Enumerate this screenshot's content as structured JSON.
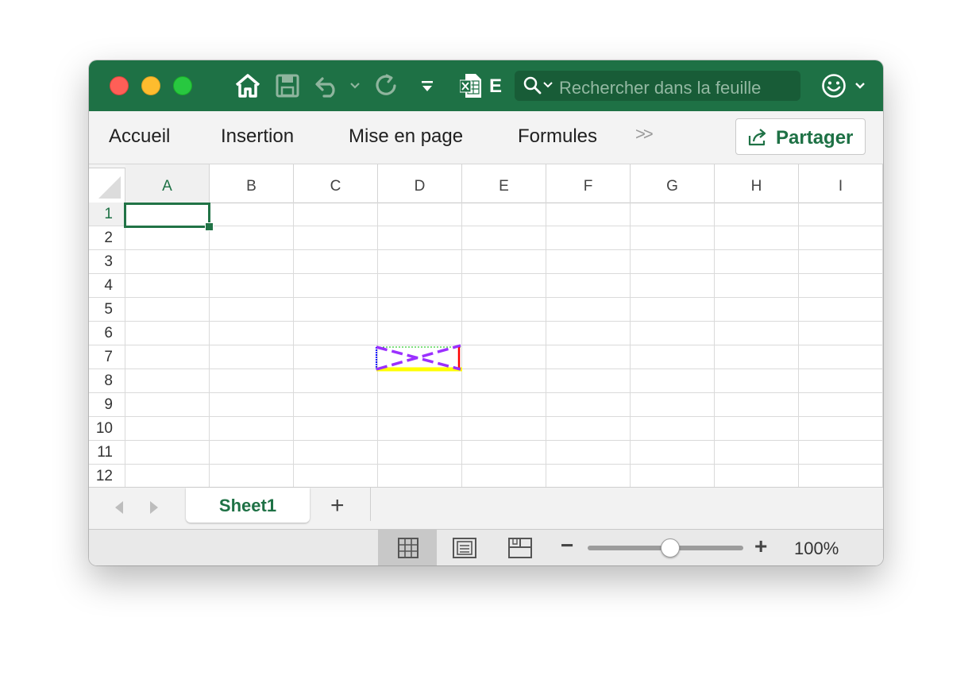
{
  "titlebar": {
    "title_fragment": "E",
    "search_placeholder": "Rechercher dans la feuille"
  },
  "ribbon": {
    "tabs": [
      "Accueil",
      "Insertion",
      "Mise en page",
      "Formules"
    ],
    "more_label": ">>",
    "share_label": "Partager"
  },
  "grid": {
    "columns": [
      "A",
      "B",
      "C",
      "D",
      "E",
      "F",
      "G",
      "H",
      "I"
    ],
    "rows": [
      "1",
      "2",
      "3",
      "4",
      "5",
      "6",
      "7",
      "8",
      "9",
      "10",
      "11",
      "12"
    ],
    "active_cell": "A1"
  },
  "sheets": {
    "tabs": [
      "Sheet1"
    ],
    "add_label": "+"
  },
  "status": {
    "zoom_minus": "−",
    "zoom_plus": "+",
    "zoom_value": 100,
    "zoom_label": "100%"
  },
  "colors": {
    "brand": "#1e7145",
    "selection": "#217346",
    "border_purple": "#9b30ff",
    "border_yellow": "#ffff00",
    "border_red": "#ff0000",
    "border_blue": "#0000ff",
    "border_green": "#00c000"
  },
  "icons": [
    "home-icon",
    "save-icon",
    "undo-icon",
    "redo-icon",
    "customize-toolbar-icon",
    "excel-doc-icon",
    "search-icon",
    "smiley-icon",
    "share-icon",
    "normal-view-icon",
    "page-layout-icon",
    "page-break-icon"
  ]
}
